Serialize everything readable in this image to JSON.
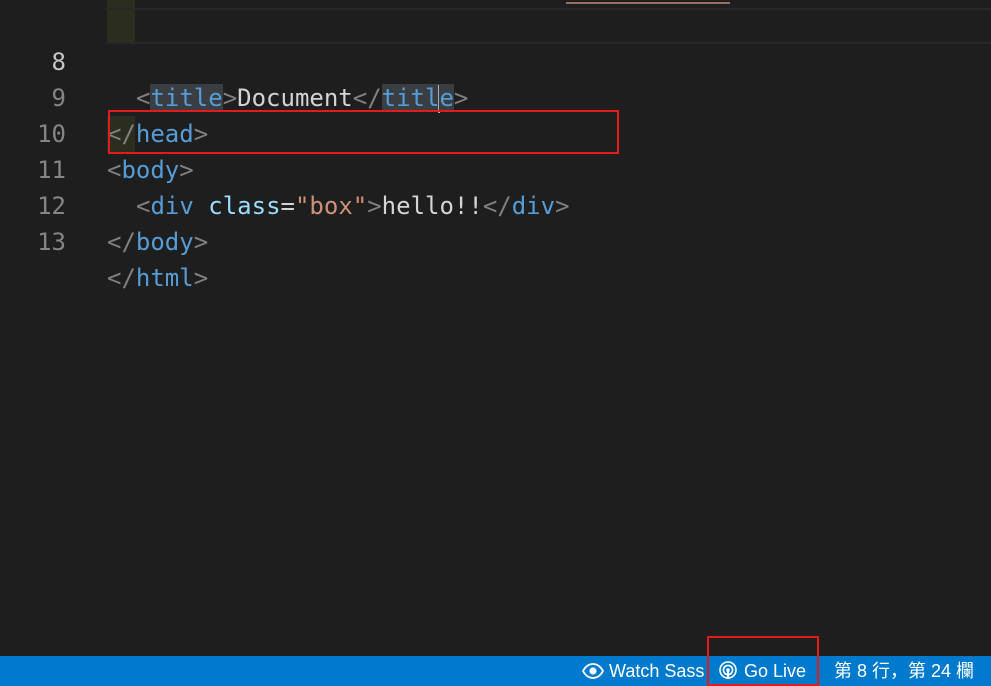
{
  "editor": {
    "lines": [
      {
        "number": "8",
        "tokens": [
          "<",
          "title",
          ">",
          "Document",
          "</",
          "tit",
          "l",
          "e",
          ">"
        ]
      },
      {
        "number": "9",
        "tokens": [
          "</",
          "head",
          ">"
        ]
      },
      {
        "number": "10",
        "tokens": [
          "<",
          "body",
          ">"
        ]
      },
      {
        "number": "11",
        "tokens": [
          "<",
          "div",
          " ",
          "class",
          "=",
          "\"box\"",
          ">",
          "hello!!",
          "</",
          "div",
          ">"
        ]
      },
      {
        "number": "12",
        "tokens": [
          "</",
          "body",
          ">"
        ]
      },
      {
        "number": "13",
        "tokens": [
          "</",
          "html",
          ">"
        ]
      }
    ]
  },
  "statusbar": {
    "watch_sass": "Watch Sass",
    "go_live": "Go Live",
    "cursor_position": "第 8 行，第 24 欄"
  },
  "colors": {
    "statusbar_bg": "#007acc",
    "editor_bg": "#1e1e1e",
    "highlight_box": "#e51a1a",
    "tag": "#569cd6",
    "attribute": "#9cdcfe",
    "string": "#ce9178",
    "punctuation": "#808080",
    "text": "#d4d4d4"
  }
}
